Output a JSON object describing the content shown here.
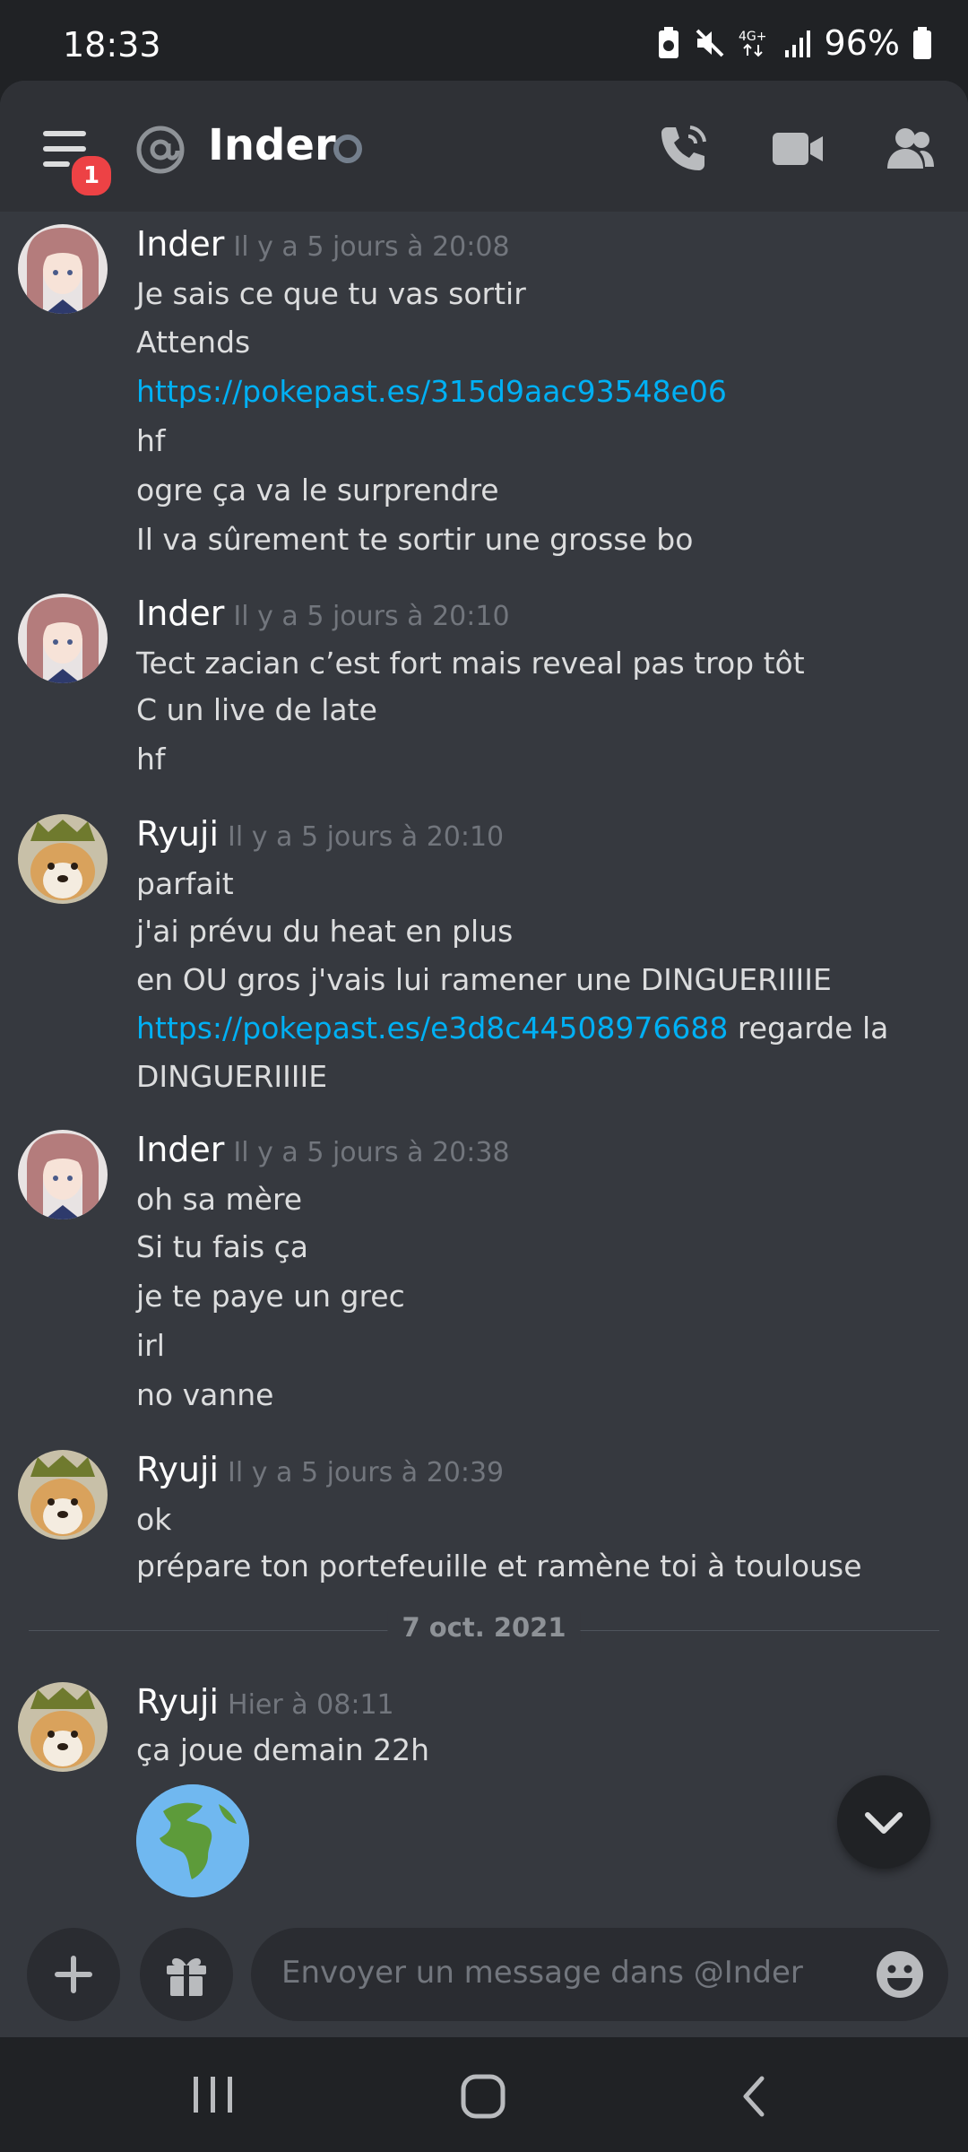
{
  "status_bar": {
    "time": "18:33",
    "battery": "96%",
    "network": "4G+"
  },
  "header": {
    "title": "Inder",
    "badge": "1"
  },
  "messages": [
    {
      "author": "Inder",
      "timestamp": "Il y a 5 jours à 20:08",
      "lines": [
        "Je sais ce que tu vas sortir",
        "Attends",
        "https://pokepast.es/315d9aac93548e06",
        "hf",
        "ogre ça va le surprendre",
        "Il va sûrement te sortir une grosse bo"
      ]
    },
    {
      "author": "Inder",
      "timestamp": "Il y a 5 jours à 20:10",
      "lines": [
        "Tect zacian c’est fort mais reveal pas trop tôt",
        "C un live de late",
        "hf"
      ]
    },
    {
      "author": "Ryuji",
      "timestamp": "Il y a 5 jours à 20:10",
      "lines": [
        "parfait",
        "j'ai prévu du heat en plus",
        "en OU gros j'vais lui ramener une DINGUERIIIIE",
        "https://pokepast.es/e3d8c44508976688",
        " regarde la",
        "DINGUERIIIIE"
      ]
    },
    {
      "author": "Inder",
      "timestamp": "Il y a 5 jours à 20:38",
      "lines": [
        "oh sa mère",
        "Si tu fais ça",
        "je te paye un grec",
        "irl",
        "no vanne"
      ]
    },
    {
      "author": "Ryuji",
      "timestamp": "Il y a 5 jours à 20:39",
      "lines": [
        "ok",
        "prépare ton portefeuille et ramène toi à toulouse"
      ]
    },
    {
      "author": "Ryuji",
      "timestamp": "Hier à 08:11",
      "lines": [
        "ça joue demain 22h"
      ]
    }
  ],
  "date_divider": "7 oct. 2021",
  "composer": {
    "placeholder": "Envoyer un message dans @Inder"
  },
  "colors": {
    "link": "#00b0f4",
    "badge": "#ed4245",
    "background": "#36393f",
    "header": "#2f3136"
  }
}
